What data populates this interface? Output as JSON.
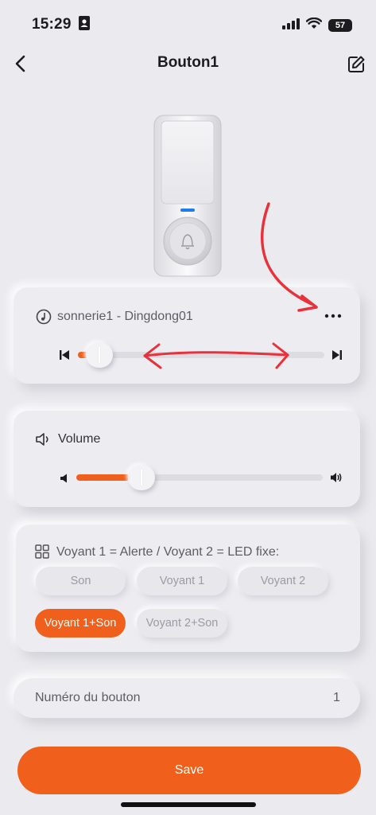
{
  "status": {
    "time": "15:29",
    "battery": "57"
  },
  "header": {
    "title": "Bouton1"
  },
  "ringtone": {
    "name": "sonnerie1 - Dingdong01"
  },
  "volume": {
    "label": "Volume",
    "level": 0.3
  },
  "mode": {
    "title": "Voyant 1 = Alerte / Voyant 2 = LED fixe:",
    "options": [
      "Son",
      "Voyant 1",
      "Voyant 2",
      "Voyant 1+Son",
      "Voyant 2+Son"
    ],
    "selected": "Voyant 1+Son"
  },
  "button_number": {
    "label": "Numéro du bouton",
    "value": "1"
  },
  "save_label": "Save",
  "colors": {
    "accent": "#f0601c",
    "annotation": "#e8313a"
  }
}
